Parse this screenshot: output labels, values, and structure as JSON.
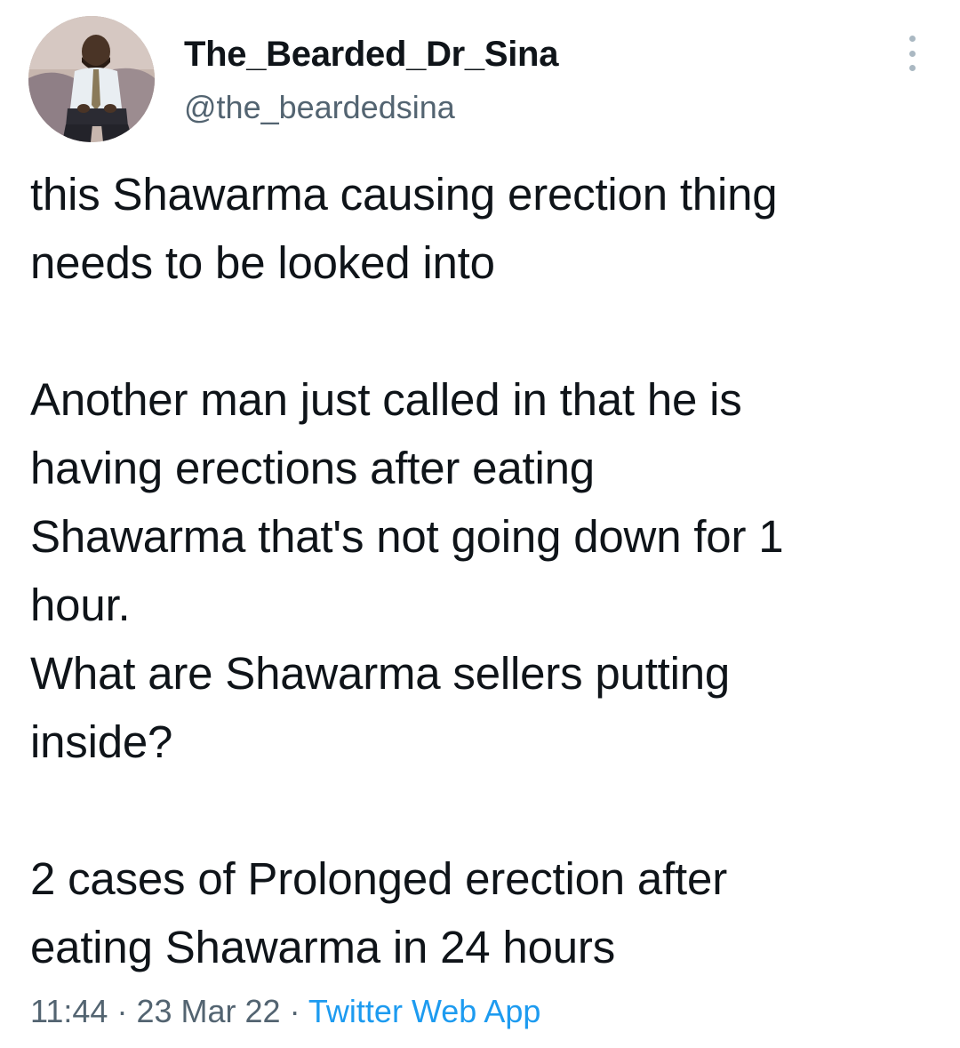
{
  "author": {
    "display_name": "The_Bearded_Dr_Sina",
    "handle": "@the_beardedsina"
  },
  "tweet": {
    "text": "this Shawarma causing erection thing\nneeds to be looked into\n\nAnother man just called in that he is\nhaving erections after eating\nShawarma that's not going down for 1\nhour.\nWhat are Shawarma sellers putting\ninside?\n\n2 cases of Prolonged erection after\neating Shawarma in 24 hours",
    "time": "11:44",
    "date": "23 Mar 22",
    "separator": "·",
    "source": "Twitter Web App"
  },
  "icons": {
    "more": "more-vertical-icon",
    "avatar": "profile-photo"
  },
  "colors": {
    "text": "#0f1419",
    "secondary": "#536471",
    "link": "#1d9bf0",
    "background": "#ffffff"
  }
}
